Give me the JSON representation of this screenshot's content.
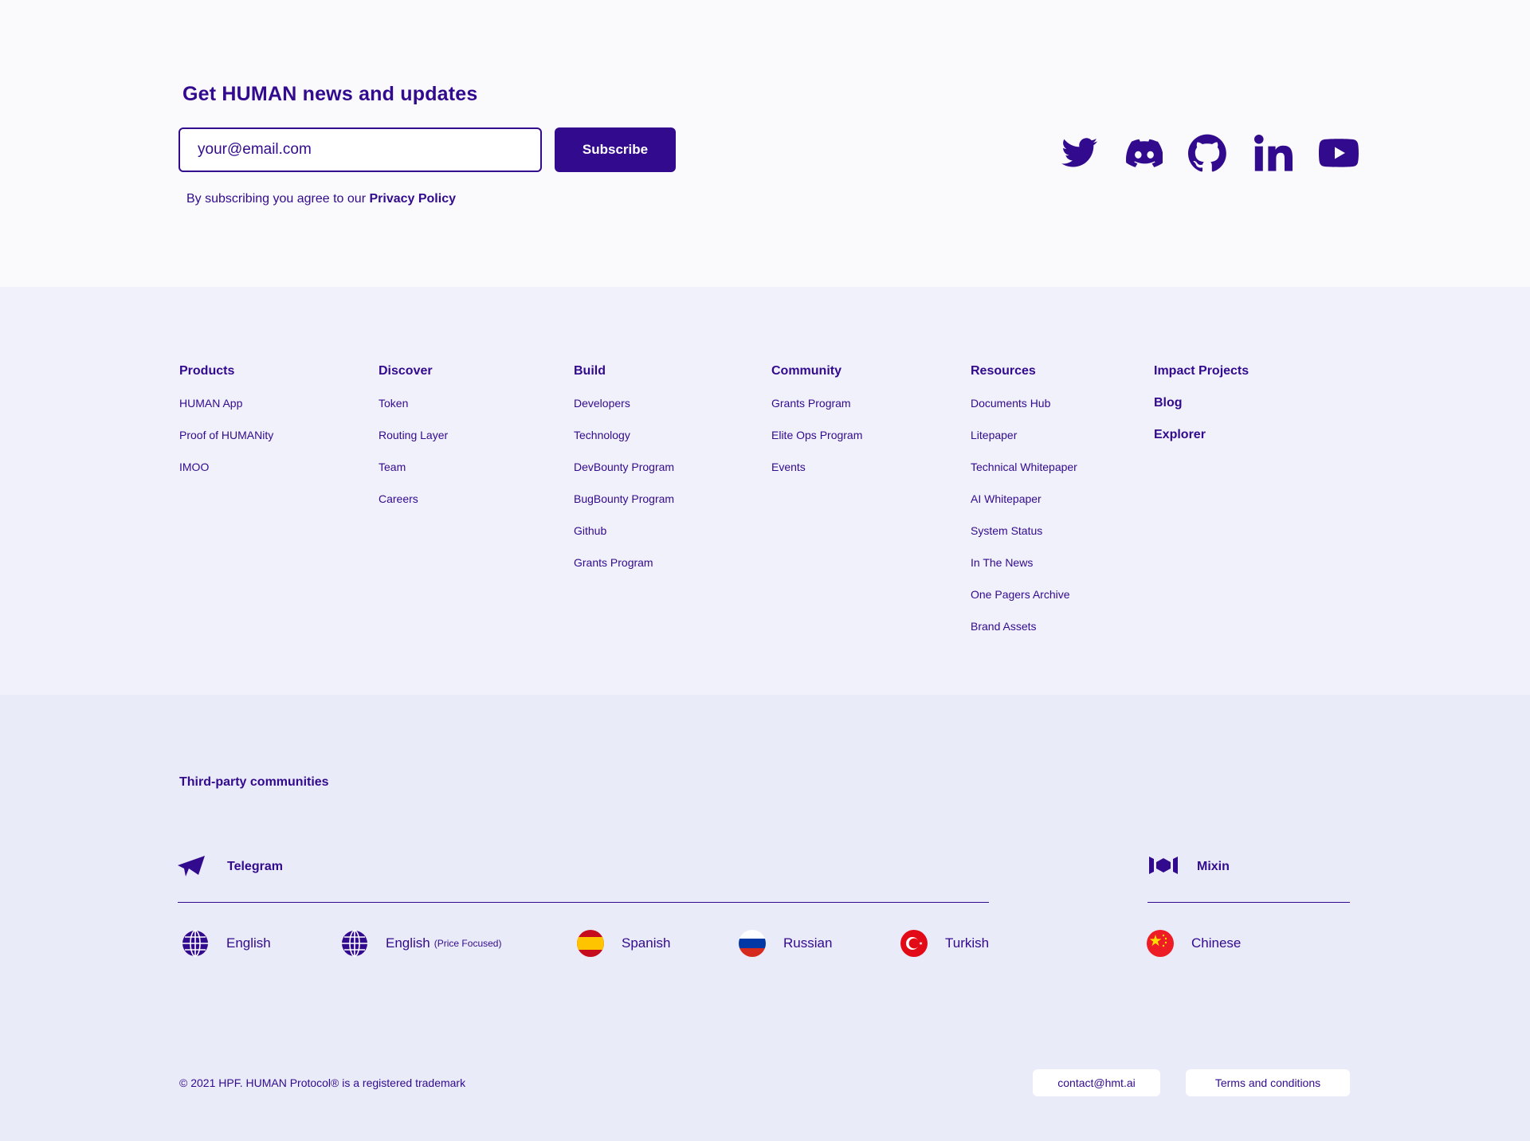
{
  "newsletter": {
    "title": "Get HUMAN news and updates",
    "email_placeholder": "your@email.com",
    "subscribe_label": "Subscribe",
    "consent_prefix": "By subscribing you agree to our",
    "privacy_link": "Privacy Policy"
  },
  "social": [
    "twitter-icon",
    "discord-icon",
    "github-icon",
    "linkedin-icon",
    "youtube-icon"
  ],
  "columns": {
    "products": {
      "heading": "Products",
      "items": [
        "HUMAN App",
        "Proof of HUMANity",
        "IMOO"
      ]
    },
    "discover": {
      "heading": "Discover",
      "items": [
        "Token",
        "Routing Layer",
        "Team",
        "Careers"
      ]
    },
    "build": {
      "heading": "Build",
      "items": [
        "Developers",
        "Technology",
        "DevBounty Program",
        "BugBounty Program",
        "Github",
        "Grants Program"
      ]
    },
    "community": {
      "heading": "Community",
      "items": [
        "Grants Program",
        "Elite Ops Program",
        "Events"
      ]
    },
    "resources": {
      "heading": "Resources",
      "items": [
        "Documents Hub",
        "Litepaper",
        "Technical Whitepaper",
        "AI Whitepaper",
        "System Status",
        "In The News",
        "One Pagers Archive",
        "Brand Assets"
      ]
    },
    "impact": {
      "heading": "Impact Projects",
      "items": [
        "Blog",
        "Explorer"
      ]
    }
  },
  "communities": {
    "title": "Third-party communities",
    "telegram": "Telegram",
    "mixin": "Mixin",
    "languages": {
      "english": "English",
      "english_price": "English",
      "english_price_note": "(Price Focused)",
      "spanish": "Spanish",
      "russian": "Russian",
      "turkish": "Turkish",
      "chinese": "Chinese"
    }
  },
  "footer": {
    "copyright": "© 2021 HPF. HUMAN Protocol® is a registered trademark",
    "contact": "contact@hmt.ai",
    "terms": "Terms and conditions"
  },
  "colors": {
    "brand": "#320a8d",
    "bg_top": "#fafafc",
    "bg_links": "#f1f1fb",
    "bg_comm": "#eaebf8"
  }
}
